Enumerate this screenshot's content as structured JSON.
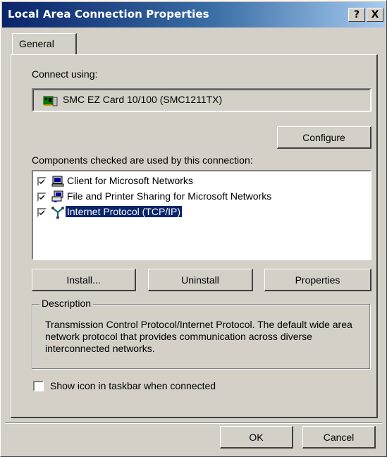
{
  "window": {
    "title": "Local Area Connection Properties",
    "help_label": "?",
    "close_label": "X"
  },
  "tabs": [
    {
      "label": "General"
    }
  ],
  "connect_using": {
    "label": "Connect using:",
    "adapter_name": "SMC EZ Card 10/100 (SMC1211TX)",
    "adapter_icon": "network-card-icon"
  },
  "configure_label": "Configure",
  "components": {
    "label": "Components checked are used by this connection:",
    "items": [
      {
        "label": "Client for Microsoft Networks",
        "checked": true,
        "icon": "client-network-icon",
        "selected": false
      },
      {
        "label": "File and Printer Sharing for Microsoft Networks",
        "checked": true,
        "icon": "file-printer-sharing-icon",
        "selected": false
      },
      {
        "label": "Internet Protocol (TCP/IP)",
        "checked": true,
        "icon": "protocol-icon",
        "selected": true
      }
    ]
  },
  "buttons": {
    "install": "Install...",
    "uninstall": "Uninstall",
    "properties": "Properties",
    "ok": "OK",
    "cancel": "Cancel"
  },
  "description": {
    "title": "Description",
    "text": "Transmission Control Protocol/Internet Protocol. The default wide area network protocol that provides communication across diverse interconnected networks."
  },
  "taskbar_option": {
    "label": "Show icon in taskbar when connected",
    "checked": false
  },
  "colors": {
    "titlebar": "#0a246a",
    "face": "#d4d0c8",
    "selection": "#0a246a"
  }
}
